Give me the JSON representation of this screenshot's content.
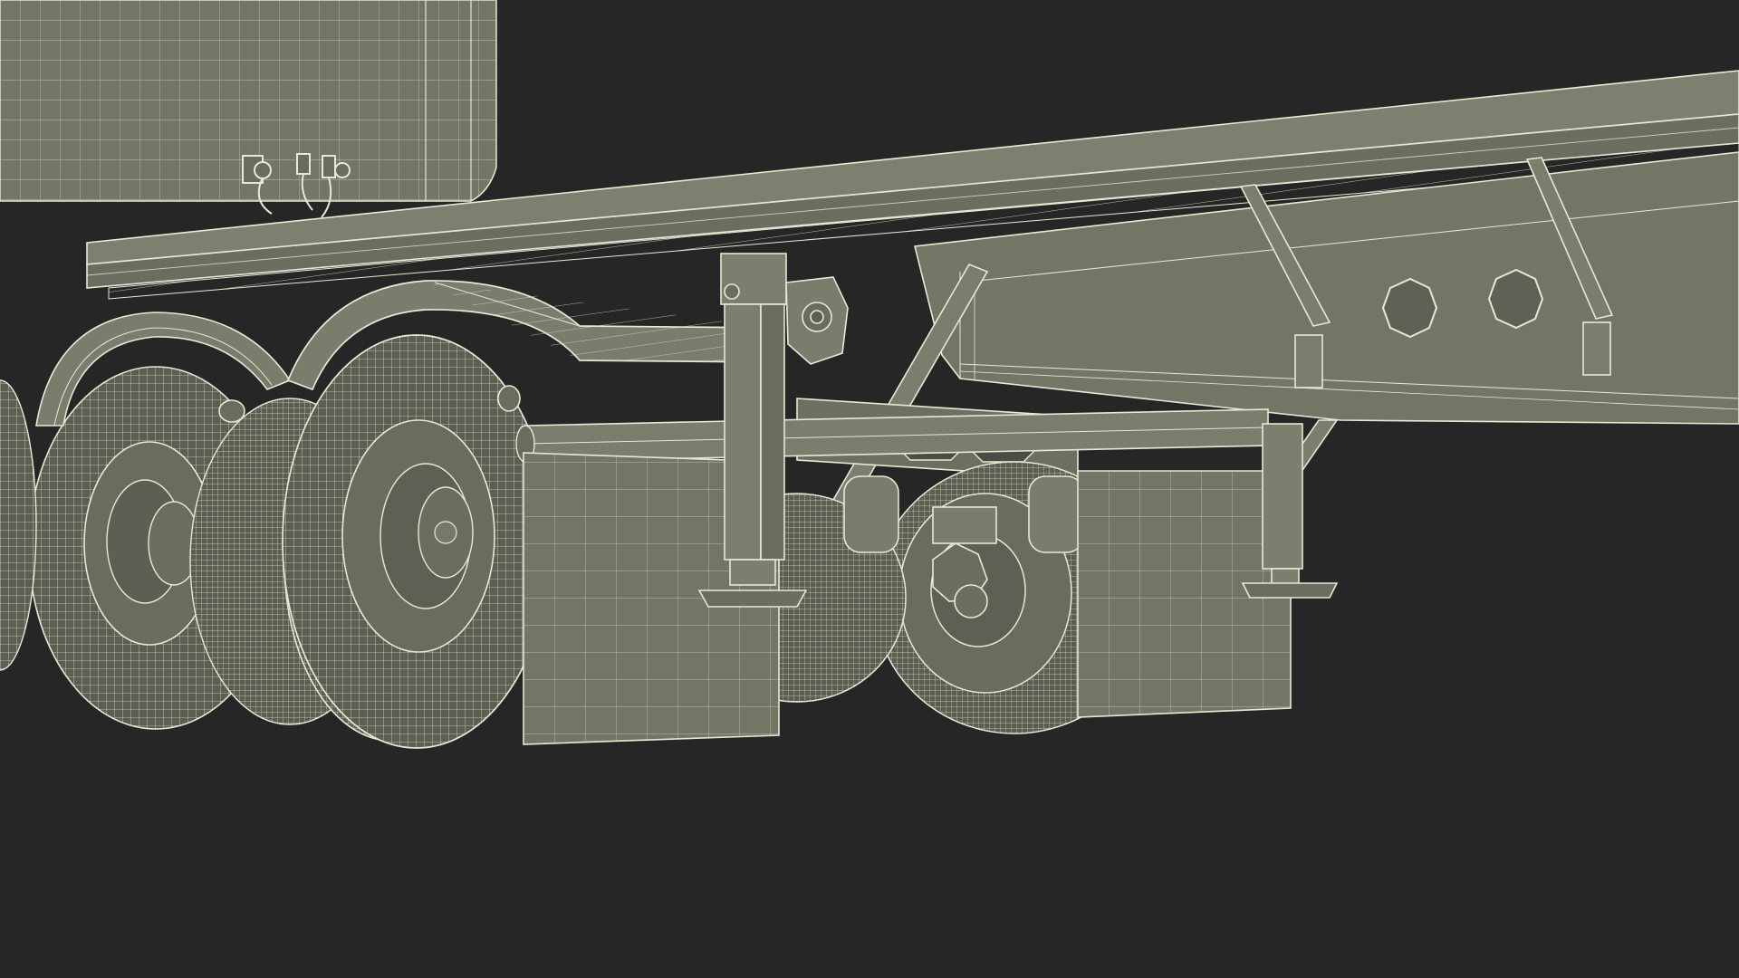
{
  "scene": {
    "subject": "flatbed-trailer-wireframe",
    "colors": {
      "background": "#262626",
      "surface": "#737565",
      "surface_dark": "#5f6154",
      "surface_light": "#858777",
      "wire": "#e9e8d6",
      "tire_fill": "#5c5e52"
    }
  }
}
